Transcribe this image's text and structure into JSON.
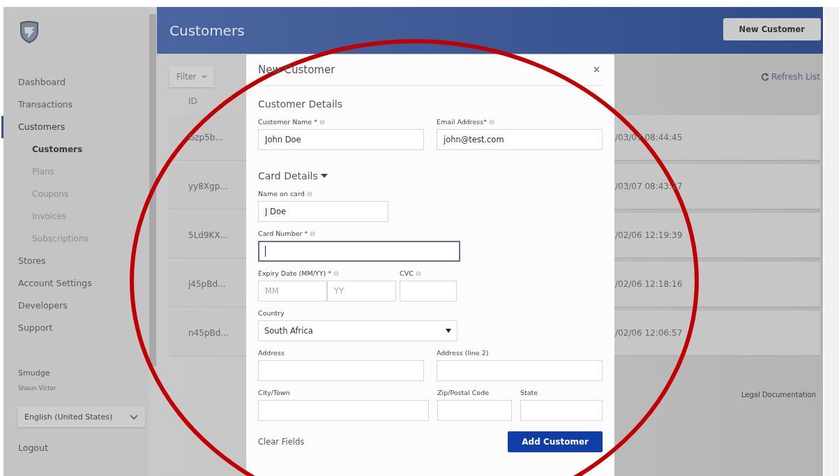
{
  "sidebar": {
    "nav": [
      {
        "label": "Dashboard",
        "selected": false
      },
      {
        "label": "Transactions",
        "selected": false
      },
      {
        "label": "Customers",
        "selected": true,
        "children": [
          {
            "label": "Customers",
            "selected": true
          },
          {
            "label": "Plans",
            "selected": false
          },
          {
            "label": "Coupons",
            "selected": false
          },
          {
            "label": "Invoices",
            "selected": false
          },
          {
            "label": "Subscriptions",
            "selected": false
          }
        ]
      },
      {
        "label": "Stores",
        "selected": false
      },
      {
        "label": "Account Settings",
        "selected": false
      },
      {
        "label": "Developers",
        "selected": false
      },
      {
        "label": "Support",
        "selected": false
      }
    ],
    "user": {
      "name": "Smudge",
      "subtitle": "Shaun Victor"
    },
    "language": "English (United States)",
    "logout": "Logout"
  },
  "header": {
    "title": "Customers",
    "button": "New Customer"
  },
  "toolbar": {
    "filter": "Filter",
    "refresh": "Refresh List"
  },
  "table": {
    "columns": [
      "ID"
    ],
    "rows": [
      {
        "column_1": "Gzp5b...",
        "column_2": "/03/07 08:44:45"
      },
      {
        "column_1": "yy8Xgp...",
        "column_2": "/03/07 08:43:27"
      },
      {
        "column_1": "5Ld9KX...",
        "column_2": "/02/06 12:19:39"
      },
      {
        "column_1": "j45pBd...",
        "column_2": "/02/06 12:18:16"
      },
      {
        "column_1": "n45pBd...",
        "column_2": "/02/06 12:06:57"
      }
    ]
  },
  "footer_link": "Legal Documentation",
  "modal": {
    "title": "New Customer",
    "close": "×",
    "sections": [
      {
        "heading": "Customer Details",
        "rows": [
          [
            {
              "kind": "text",
              "label": "Customer Name *",
              "info": true,
              "value": "John Doe",
              "focused": false
            },
            {
              "kind": "text",
              "label": "Email Address*",
              "info": true,
              "value": "john@test.com",
              "focused": false
            }
          ]
        ]
      },
      {
        "heading": "Card Details",
        "expanded": true,
        "rows": [
          [
            {
              "kind": "text",
              "label": "Name on card",
              "info": true,
              "value": "J Doe",
              "focused": false
            }
          ],
          [
            {
              "kind": "text",
              "label": "Card Number *",
              "info": true,
              "focused": true
            }
          ],
          [
            {
              "kind": "split",
              "label": "Expiry Date (MM/YY) *",
              "info": true,
              "inputs": [
                {
                  "placeholder": "MM"
                },
                {
                  "placeholder": "YY"
                }
              ]
            },
            {
              "kind": "text",
              "label": "CVC",
              "info": true,
              "focused": false
            }
          ],
          [
            {
              "kind": "select",
              "label": "Country",
              "value": "South Africa"
            }
          ],
          [
            {
              "kind": "text",
              "label": "Address",
              "focused": false
            },
            {
              "kind": "text",
              "label": "Address (line 2)",
              "focused": false
            }
          ],
          [
            {
              "kind": "text",
              "label": "City/Town",
              "focused": false
            },
            {
              "kind": "text",
              "label": "Zip/Postal Code",
              "focused": false
            },
            {
              "kind": "text",
              "label": "State",
              "focused": false
            }
          ]
        ]
      }
    ],
    "clear": "Clear Fields",
    "submit": "Add Customer"
  }
}
